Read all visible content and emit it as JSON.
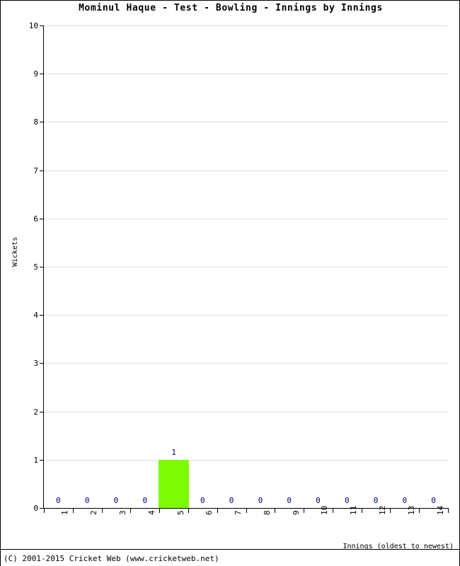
{
  "chart_data": {
    "type": "bar",
    "title": "Mominul Haque - Test - Bowling - Innings by Innings",
    "xlabel": "Innings (oldest to newest)",
    "ylabel": "Wickets",
    "categories": [
      "1",
      "2",
      "3",
      "4",
      "5",
      "6",
      "7",
      "8",
      "9",
      "10",
      "11",
      "12",
      "13",
      "14"
    ],
    "values": [
      0,
      0,
      0,
      0,
      1,
      0,
      0,
      0,
      0,
      0,
      0,
      0,
      0,
      0
    ],
    "data_labels": [
      "0",
      "0",
      "0",
      "0",
      "1",
      "0",
      "0",
      "0",
      "0",
      "0",
      "0",
      "0",
      "0",
      "0"
    ],
    "ylim": [
      0,
      10
    ],
    "y_ticks": [
      "0",
      "1",
      "2",
      "3",
      "4",
      "5",
      "6",
      "7",
      "8",
      "9",
      "10"
    ],
    "xlim_categories": 14,
    "grid": true,
    "legend": false,
    "series": [
      {
        "name": "Wickets",
        "color": "#7cfc00",
        "values": [
          0,
          0,
          0,
          0,
          1,
          0,
          0,
          0,
          0,
          0,
          0,
          0,
          0,
          0
        ]
      }
    ],
    "colors": {
      "bar": "#7cfc00",
      "data_label": "#000080",
      "gridline": "#dcdcdc",
      "axis": "#000000",
      "background": "#ffffff"
    }
  },
  "footer": {
    "copyright": "(C) 2001-2015 Cricket Web (www.cricketweb.net)"
  }
}
